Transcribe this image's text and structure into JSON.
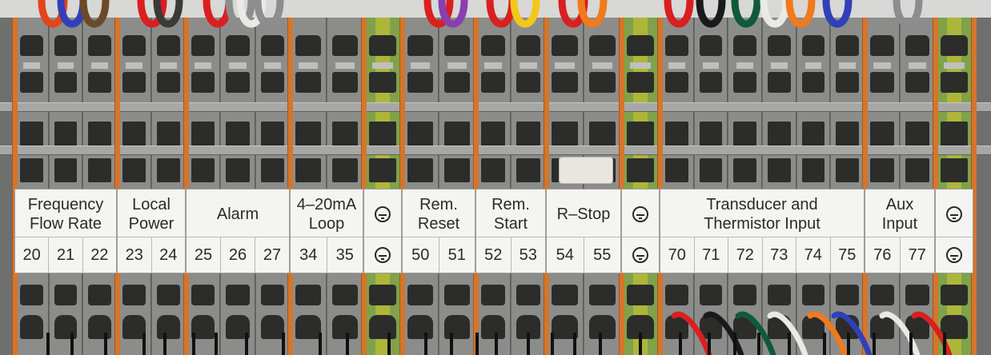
{
  "label_groups": [
    {
      "name_lines": [
        "Frequency",
        "Flow Rate"
      ],
      "numbers": [
        "20",
        "21",
        "22"
      ]
    },
    {
      "name_lines": [
        "Local",
        "Power"
      ],
      "numbers": [
        "23",
        "24"
      ]
    },
    {
      "name_lines": [
        "Alarm"
      ],
      "numbers": [
        "25",
        "26",
        "27"
      ]
    },
    {
      "name_lines": [
        "4–20mA",
        "Loop"
      ],
      "numbers": [
        "34",
        "35"
      ]
    },
    {
      "ground": true,
      "numbers": []
    },
    {
      "name_lines": [
        "Rem.",
        "Reset"
      ],
      "numbers": [
        "50",
        "51"
      ]
    },
    {
      "name_lines": [
        "Rem.",
        "Start"
      ],
      "numbers": [
        "52",
        "53"
      ]
    },
    {
      "name_lines": [
        "R–Stop"
      ],
      "numbers": [
        "54",
        "55"
      ]
    },
    {
      "ground": true,
      "numbers": []
    },
    {
      "name_lines": [
        "Transducer and",
        "Thermistor Input"
      ],
      "numbers": [
        "70",
        "71",
        "72",
        "73",
        "74",
        "75"
      ]
    },
    {
      "name_lines": [
        "Aux",
        "Input"
      ],
      "numbers": [
        "76",
        "77"
      ]
    },
    {
      "ground": true,
      "numbers": []
    }
  ],
  "colors": {
    "terminal_gray": "#8c8d8a",
    "separator_orange": "#d6752a",
    "ground_green": "#7fa24a",
    "label_white": "#f4f4f2",
    "wire_colors": [
      "#e2451c",
      "#3040b8",
      "#6b4a2a",
      "#d91f1f",
      "#3a3a38",
      "#8d8d8d",
      "#e9e9e6",
      "#8a3fb0",
      "#f2c81a",
      "#f07a1c",
      "#0f5a3a",
      "#1a1a1a"
    ]
  }
}
